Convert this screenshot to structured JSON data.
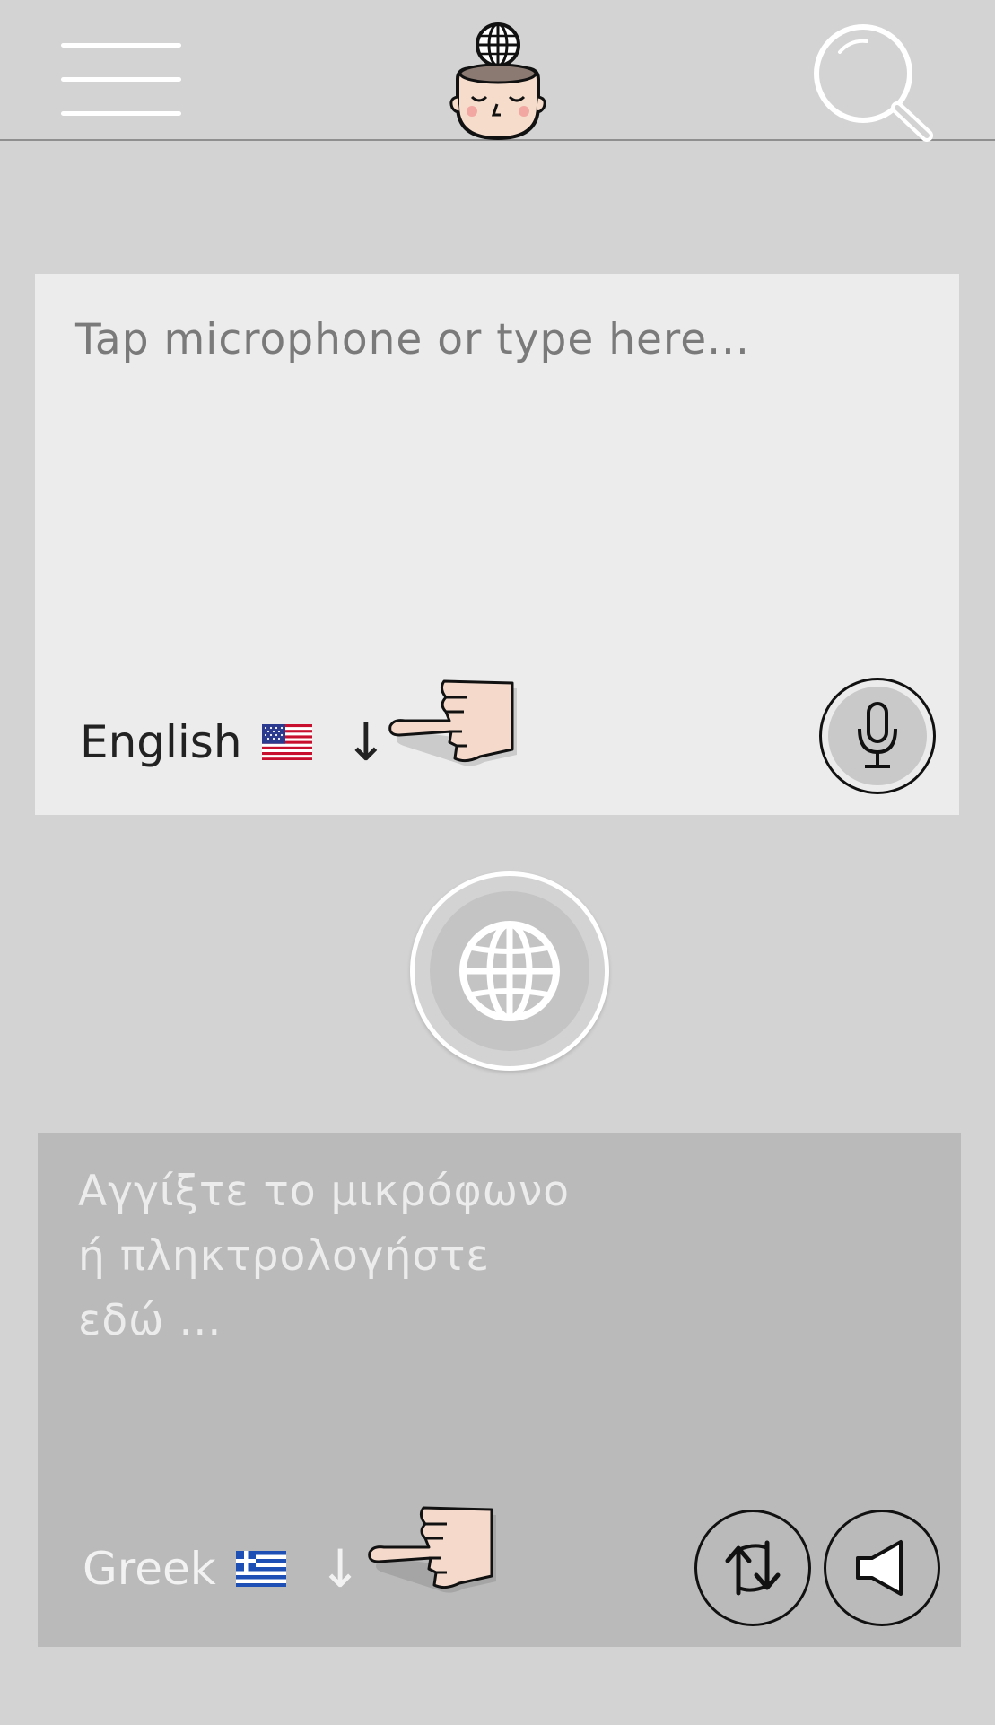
{
  "header": {
    "menu_icon": "hamburger-menu-icon",
    "logo_icon": "head-with-globe-logo",
    "search_icon": "magnifier-icon"
  },
  "source_panel": {
    "placeholder": "Tap microphone or type here...",
    "language": "English",
    "flag": "🇺🇸",
    "dropdown_arrow": "↓",
    "hint_icon": "pointing-hand-icon",
    "mic_icon": "microphone-icon"
  },
  "translate_button": {
    "icon": "globe-icon"
  },
  "target_panel": {
    "placeholder": "Αγγίξτε το μικρόφωνο ή πληκτρολογήστε εδώ ...",
    "language": "Greek",
    "flag": "🇬🇷",
    "dropdown_arrow": "↓",
    "hint_icon": "pointing-hand-icon",
    "swap_icon": "swap-arrows-icon",
    "speaker_icon": "speaker-icon"
  },
  "colors": {
    "background": "#d3d3d3",
    "source_panel": "#ececec",
    "target_panel": "#bababa",
    "header_icons": "#ffffff"
  }
}
